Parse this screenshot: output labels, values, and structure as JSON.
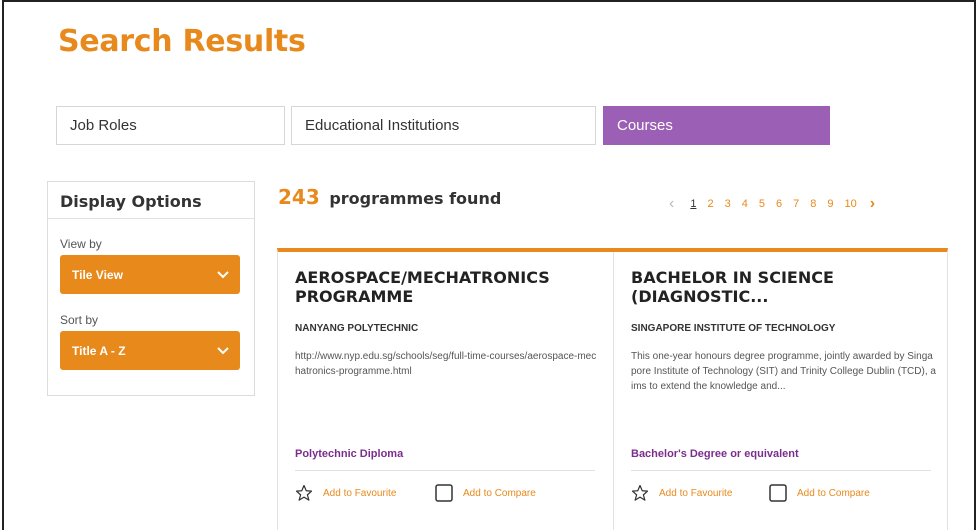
{
  "page": {
    "title": "Search Results"
  },
  "tabs": [
    {
      "label": "Job Roles",
      "active": false
    },
    {
      "label": "Educational Institutions",
      "active": false
    },
    {
      "label": "Courses",
      "active": true
    }
  ],
  "display_options": {
    "title": "Display Options",
    "view_by": {
      "label": "View by",
      "value": "Tile View"
    },
    "sort_by": {
      "label": "Sort by",
      "value": "Title A - Z"
    }
  },
  "results": {
    "count": "243",
    "text": "programmes found"
  },
  "pagination": {
    "pages": [
      "1",
      "2",
      "3",
      "4",
      "5",
      "6",
      "7",
      "8",
      "9",
      "10"
    ],
    "current": "1",
    "prev_icon": "chevron-left-icon",
    "next_icon": "chevron-right-icon"
  },
  "cards": [
    {
      "title": "AEROSPACE/MECHATRONICS PROGRAMME",
      "institution": "NANYANG POLYTECHNIC",
      "description": "http://www.nyp.edu.sg/schools/seg/full-time-courses/aerospace-mechatronics-programme.html",
      "qualification": "Polytechnic Diploma",
      "favourite_label": "Add to Favourite",
      "compare_label": "Add to Compare"
    },
    {
      "title": "BACHELOR IN SCIENCE (DIAGNOSTIC...",
      "institution": "SINGAPORE INSTITUTE OF TECHNOLOGY",
      "description": "This one-year honours degree programme, jointly awarded by Singapore Institute of Technology (SIT) and Trinity College Dublin (TCD), aims to extend the knowledge and...",
      "qualification": "Bachelor's Degree or equivalent",
      "favourite_label": "Add to Favourite",
      "compare_label": "Add to Compare"
    }
  ],
  "colors": {
    "accent": "#e8891c",
    "purple": "#9b5fb5",
    "qualification": "#7b2d8e"
  }
}
